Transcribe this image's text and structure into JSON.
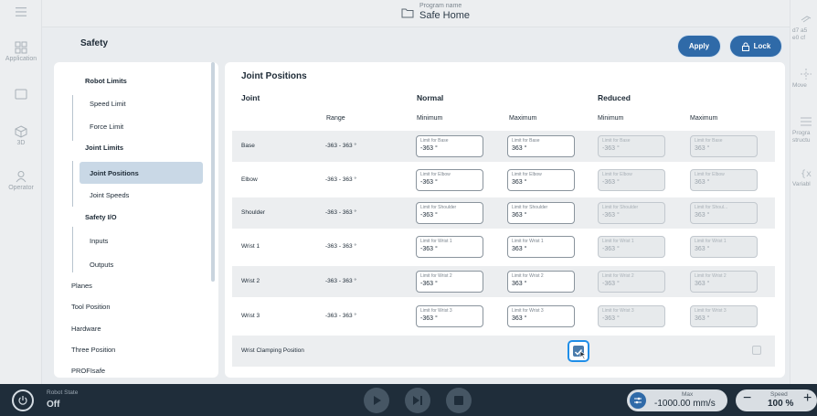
{
  "top": {
    "program_label": "Program name",
    "program_name": "Safe Home"
  },
  "left_rail": {
    "items": [
      {
        "label": "Application",
        "icon": "grid-icon"
      },
      {
        "label": "",
        "icon": "window-icon"
      },
      {
        "label": "3D",
        "icon": "cube-icon"
      },
      {
        "label": "Operator",
        "icon": "person-icon"
      }
    ]
  },
  "right_rail": {
    "items": [
      {
        "label": "d7 a5\ne0 cf",
        "icon": "hand-icon"
      },
      {
        "label": "Move",
        "icon": "move-icon"
      },
      {
        "label": "Progra\nstructu",
        "icon": "list-icon"
      },
      {
        "label": "Variabl",
        "icon": "braces-icon"
      }
    ]
  },
  "header": {
    "title": "Safety",
    "apply_label": "Apply",
    "lock_label": "Lock"
  },
  "nav": {
    "items": [
      {
        "label": "Robot Limits",
        "bold": true
      },
      {
        "label": "Speed Limit",
        "bold": false
      },
      {
        "label": "Force Limit",
        "bold": false
      },
      {
        "label": "Joint Limits",
        "bold": true
      },
      {
        "label": "Joint Positions",
        "bold": true,
        "selected": true
      },
      {
        "label": "Joint Speeds",
        "bold": false
      },
      {
        "label": "Safety I/O",
        "bold": true
      },
      {
        "label": "Inputs",
        "bold": false
      },
      {
        "label": "Outputs",
        "bold": false
      },
      {
        "label": "Planes",
        "bold": false
      },
      {
        "label": "Tool Position",
        "bold": false
      },
      {
        "label": "Hardware",
        "bold": false
      },
      {
        "label": "Three Position",
        "bold": false
      },
      {
        "label": "PROFIsafe",
        "bold": false
      }
    ]
  },
  "main": {
    "title": "Joint Positions",
    "col_joint": "Joint",
    "col_normal": "Normal",
    "col_reduced": "Reduced",
    "sub_range": "Range",
    "sub_min": "Minimum",
    "sub_max": "Maximum",
    "sub_min2": "Minimum",
    "sub_max2": "Maximum",
    "rows": [
      {
        "joint": "Base",
        "range": "-363 - 363 °",
        "fields": [
          {
            "label": "Limit for Base",
            "value": "-363 °"
          },
          {
            "label": "Limit for Base",
            "value": "363 °"
          },
          {
            "label": "Limit for Base",
            "value": "-363 °"
          },
          {
            "label": "Limit for Base",
            "value": "363 °"
          }
        ]
      },
      {
        "joint": "Elbow",
        "range": "-363 - 363 °",
        "fields": [
          {
            "label": "Limit for Elbow",
            "value": "-363 °"
          },
          {
            "label": "Limit for Elbow",
            "value": "363 °"
          },
          {
            "label": "Limit for Elbow",
            "value": "-363 °"
          },
          {
            "label": "Limit for Elbow",
            "value": "363 °"
          }
        ]
      },
      {
        "joint": "Shoulder",
        "range": "-363 - 363 °",
        "fields": [
          {
            "label": "Limit for Shoulder",
            "value": "-363 °"
          },
          {
            "label": "Limit for Shoulder",
            "value": "363 °"
          },
          {
            "label": "Limit for Shoulder",
            "value": "-363 °"
          },
          {
            "label": "Limit for Shoul...",
            "value": "363 °"
          }
        ]
      },
      {
        "joint": "Wrist 1",
        "range": "-363 - 363 °",
        "fields": [
          {
            "label": "Limit for Wrist 1",
            "value": "-363 °"
          },
          {
            "label": "Limit for Wrist 1",
            "value": "363 °"
          },
          {
            "label": "Limit for Wrist 1",
            "value": "-363 °"
          },
          {
            "label": "Limit for Wrist 1",
            "value": "363 °"
          }
        ]
      },
      {
        "joint": "Wrist 2",
        "range": "-363 - 363 °",
        "fields": [
          {
            "label": "Limit for Wrist 2",
            "value": "-363 °"
          },
          {
            "label": "Limit for Wrist 2",
            "value": "363 °"
          },
          {
            "label": "Limit for Wrist 2",
            "value": "-363 °"
          },
          {
            "label": "Limit for Wrist 2",
            "value": "363 °"
          }
        ]
      },
      {
        "joint": "Wrist 3",
        "range": "-363 - 363 °",
        "fields": [
          {
            "label": "Limit for Wrist 3",
            "value": "-363 °"
          },
          {
            "label": "Limit for Wrist 3",
            "value": "363 °"
          },
          {
            "label": "Limit for Wrist 3",
            "value": "-363 °"
          },
          {
            "label": "Limit for Wrist 3",
            "value": "363 °"
          }
        ]
      }
    ],
    "wrist_clamping_label": "Wrist Clamping Position",
    "wrist_clamping_normal": true,
    "wrist_clamping_reduced": false
  },
  "bottom": {
    "robot_state_label": "Robot State",
    "robot_state_value": "Off",
    "max_label": "Max",
    "max_value": "-1000.00 mm/s",
    "speed_label": "Speed",
    "speed_value": "100 %"
  },
  "colors": {
    "accent": "#2f6aa8",
    "focus": "#1f8ee8",
    "bottom_bar": "#1f2d3a"
  }
}
